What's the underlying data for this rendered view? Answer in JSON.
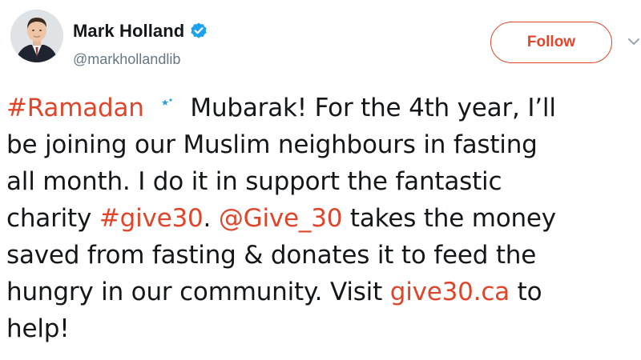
{
  "user": {
    "display_name": "Mark Holland",
    "handle": "@markhollandlib",
    "verified": true,
    "avatar_icon": "avatar-photo"
  },
  "follow_button": {
    "label": "Follow",
    "color": "#e0452a"
  },
  "tweet": {
    "emoji_icon": "crescent-moon-star-emoji",
    "segments": {
      "hashtag_ramadan": "#Ramadan",
      "t1": " Mubarak!  For the 4th year, I’ll",
      "t2": "be joining our Muslim neighbours in fasting",
      "t3": "all month. I do it in support the fantastic",
      "t4a": "charity ",
      "hashtag_give30": "#give30",
      "t4b": ".  ",
      "mention_give30": "@Give_30",
      "t4c": " takes the money",
      "t5": "saved from fasting & donates it to feed the",
      "t6a": "hungry in our community. Visit ",
      "link_give30": "give30.ca",
      "t6b": " to",
      "t7": "help!"
    }
  },
  "colors": {
    "link": "#e0452a",
    "text": "#14171a",
    "secondary": "#657786",
    "verified": "#1da1f2",
    "emoji": "#2d9fe0"
  }
}
